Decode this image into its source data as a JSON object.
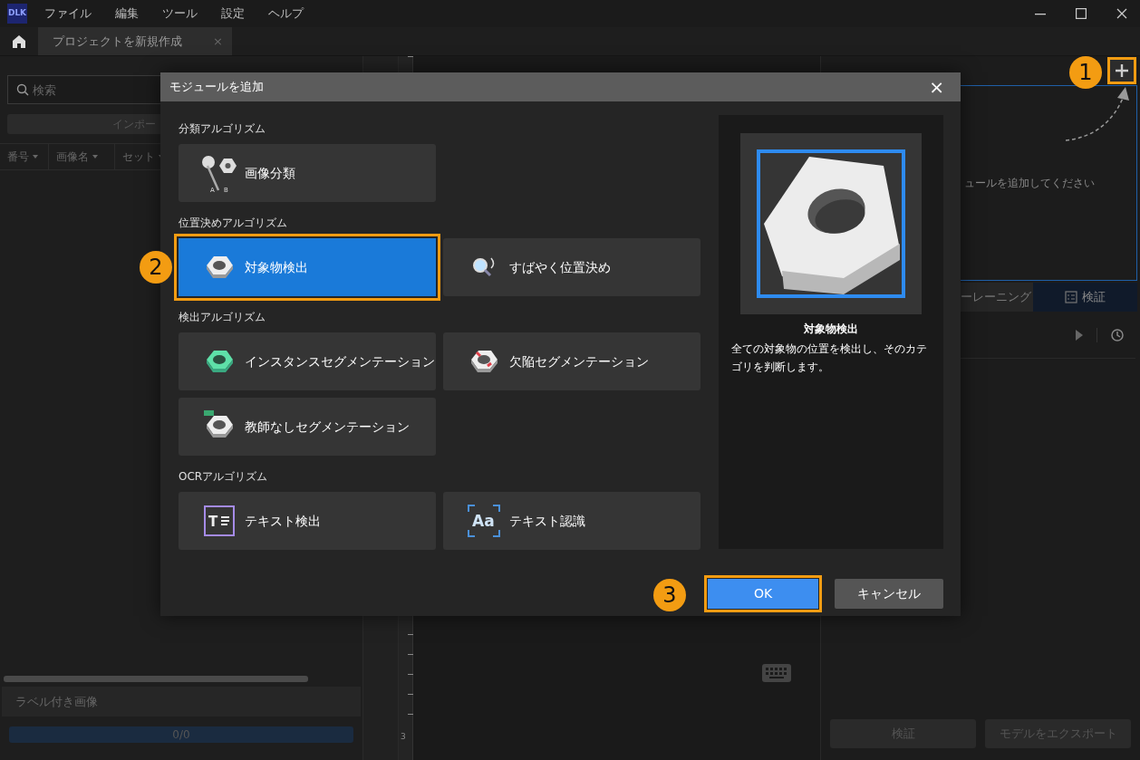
{
  "app": {
    "logo": "DLK",
    "menu": [
      "ファイル",
      "編集",
      "ツール",
      "設定",
      "ヘルプ"
    ]
  },
  "tabs": [
    {
      "label": "プロジェクトを新規作成",
      "selected": true,
      "close": "×"
    }
  ],
  "left_panel": {
    "search_placeholder": "検索",
    "import_button": "インポー",
    "columns": [
      "番号",
      "画像名",
      "セット"
    ],
    "labeled_images": "ラベル付き画像",
    "progress": {
      "level": 0,
      "reading": "0/0"
    }
  },
  "center": {
    "ruler_label": "3"
  },
  "right_panel": {
    "add_callout": "1",
    "hint": "ュールを追加してください",
    "tabs": [
      {
        "label": "ーレーニング",
        "selected": false
      },
      {
        "label": "検証",
        "selected": true
      }
    ],
    "buttons": [
      "検証",
      "モデルをエクスポート"
    ]
  },
  "dialog": {
    "title": "モジュールを追加",
    "close": "×",
    "sections": [
      {
        "title": "分類アルゴリズム",
        "modules": [
          {
            "label": "画像分類",
            "kind": "pins",
            "icon_labels": [
              "A",
              "B"
            ],
            "selected": false
          }
        ]
      },
      {
        "title": "位置決めアルゴリズム",
        "modules": [
          {
            "label": "対象物検出",
            "kind": "nut",
            "selected": true,
            "callout": "2"
          },
          {
            "label": "すばやく位置決め",
            "kind": "magnifier",
            "selected": false
          }
        ]
      },
      {
        "title": "検出アルゴリズム",
        "modules": [
          {
            "label": "インスタンスセグメンテーション",
            "kind": "greennut",
            "selected": false
          },
          {
            "label": "欠陥セグメンテーション",
            "kind": "rednut",
            "selected": false
          },
          {
            "label": "教師なしセグメンテーション",
            "kind": "tagnut",
            "selected": false
          }
        ]
      },
      {
        "title": "OCRアルゴリズム",
        "modules": [
          {
            "label": "テキスト検出",
            "kind": "textframe",
            "icon_labels": [
              "T"
            ],
            "selected": false
          },
          {
            "label": "テキスト認識",
            "kind": "letters",
            "icon_labels": [
              "Aa"
            ],
            "selected": false
          }
        ]
      }
    ],
    "preview": {
      "title": "対象物検出",
      "description": "全ての対象物の位置を検出し、そのカテゴリを判断します。"
    },
    "ok": {
      "label": "OK",
      "callout": "3"
    },
    "cancel": "キャンセル"
  }
}
